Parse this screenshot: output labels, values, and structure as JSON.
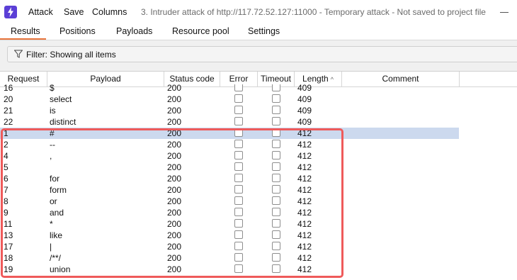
{
  "menubar": {
    "items": [
      "Attack",
      "Save",
      "Columns"
    ],
    "window_title": "3. Intruder attack of http://117.72.52.127:11000 - Temporary attack - Not saved to project file"
  },
  "tabs": [
    "Results",
    "Positions",
    "Payloads",
    "Resource pool",
    "Settings"
  ],
  "active_tab": "Results",
  "filter": {
    "text": "Filter: Showing all items"
  },
  "table": {
    "columns": [
      "Request",
      "Payload",
      "Status code",
      "Error",
      "Timeout",
      "Length",
      "Comment"
    ],
    "sorted_column": "Length",
    "rows": [
      {
        "request": "16",
        "payload": "$",
        "status": "200",
        "length": "409"
      },
      {
        "request": "20",
        "payload": "select",
        "status": "200",
        "length": "409"
      },
      {
        "request": "21",
        "payload": "is",
        "status": "200",
        "length": "409"
      },
      {
        "request": "22",
        "payload": "distinct",
        "status": "200",
        "length": "409"
      },
      {
        "request": "1",
        "payload": "#",
        "status": "200",
        "length": "412",
        "selected": true
      },
      {
        "request": "2",
        "payload": "--",
        "status": "200",
        "length": "412"
      },
      {
        "request": "4",
        "payload": ",",
        "status": "200",
        "length": "412"
      },
      {
        "request": "5",
        "payload": "",
        "status": "200",
        "length": "412"
      },
      {
        "request": "6",
        "payload": "for",
        "status": "200",
        "length": "412"
      },
      {
        "request": "7",
        "payload": "form",
        "status": "200",
        "length": "412"
      },
      {
        "request": "8",
        "payload": "or",
        "status": "200",
        "length": "412"
      },
      {
        "request": "9",
        "payload": "and",
        "status": "200",
        "length": "412"
      },
      {
        "request": "11",
        "payload": "*",
        "status": "200",
        "length": "412"
      },
      {
        "request": "13",
        "payload": "like",
        "status": "200",
        "length": "412"
      },
      {
        "request": "17",
        "payload": "|",
        "status": "200",
        "length": "412"
      },
      {
        "request": "18",
        "payload": "/**/",
        "status": "200",
        "length": "412"
      },
      {
        "request": "19",
        "payload": "union",
        "status": "200",
        "length": "412"
      }
    ]
  },
  "colors": {
    "accent": "#e8743b",
    "selection": "#ccd9ee",
    "highlight": "#ef5a5a",
    "app_icon": "#5b3fd6"
  }
}
